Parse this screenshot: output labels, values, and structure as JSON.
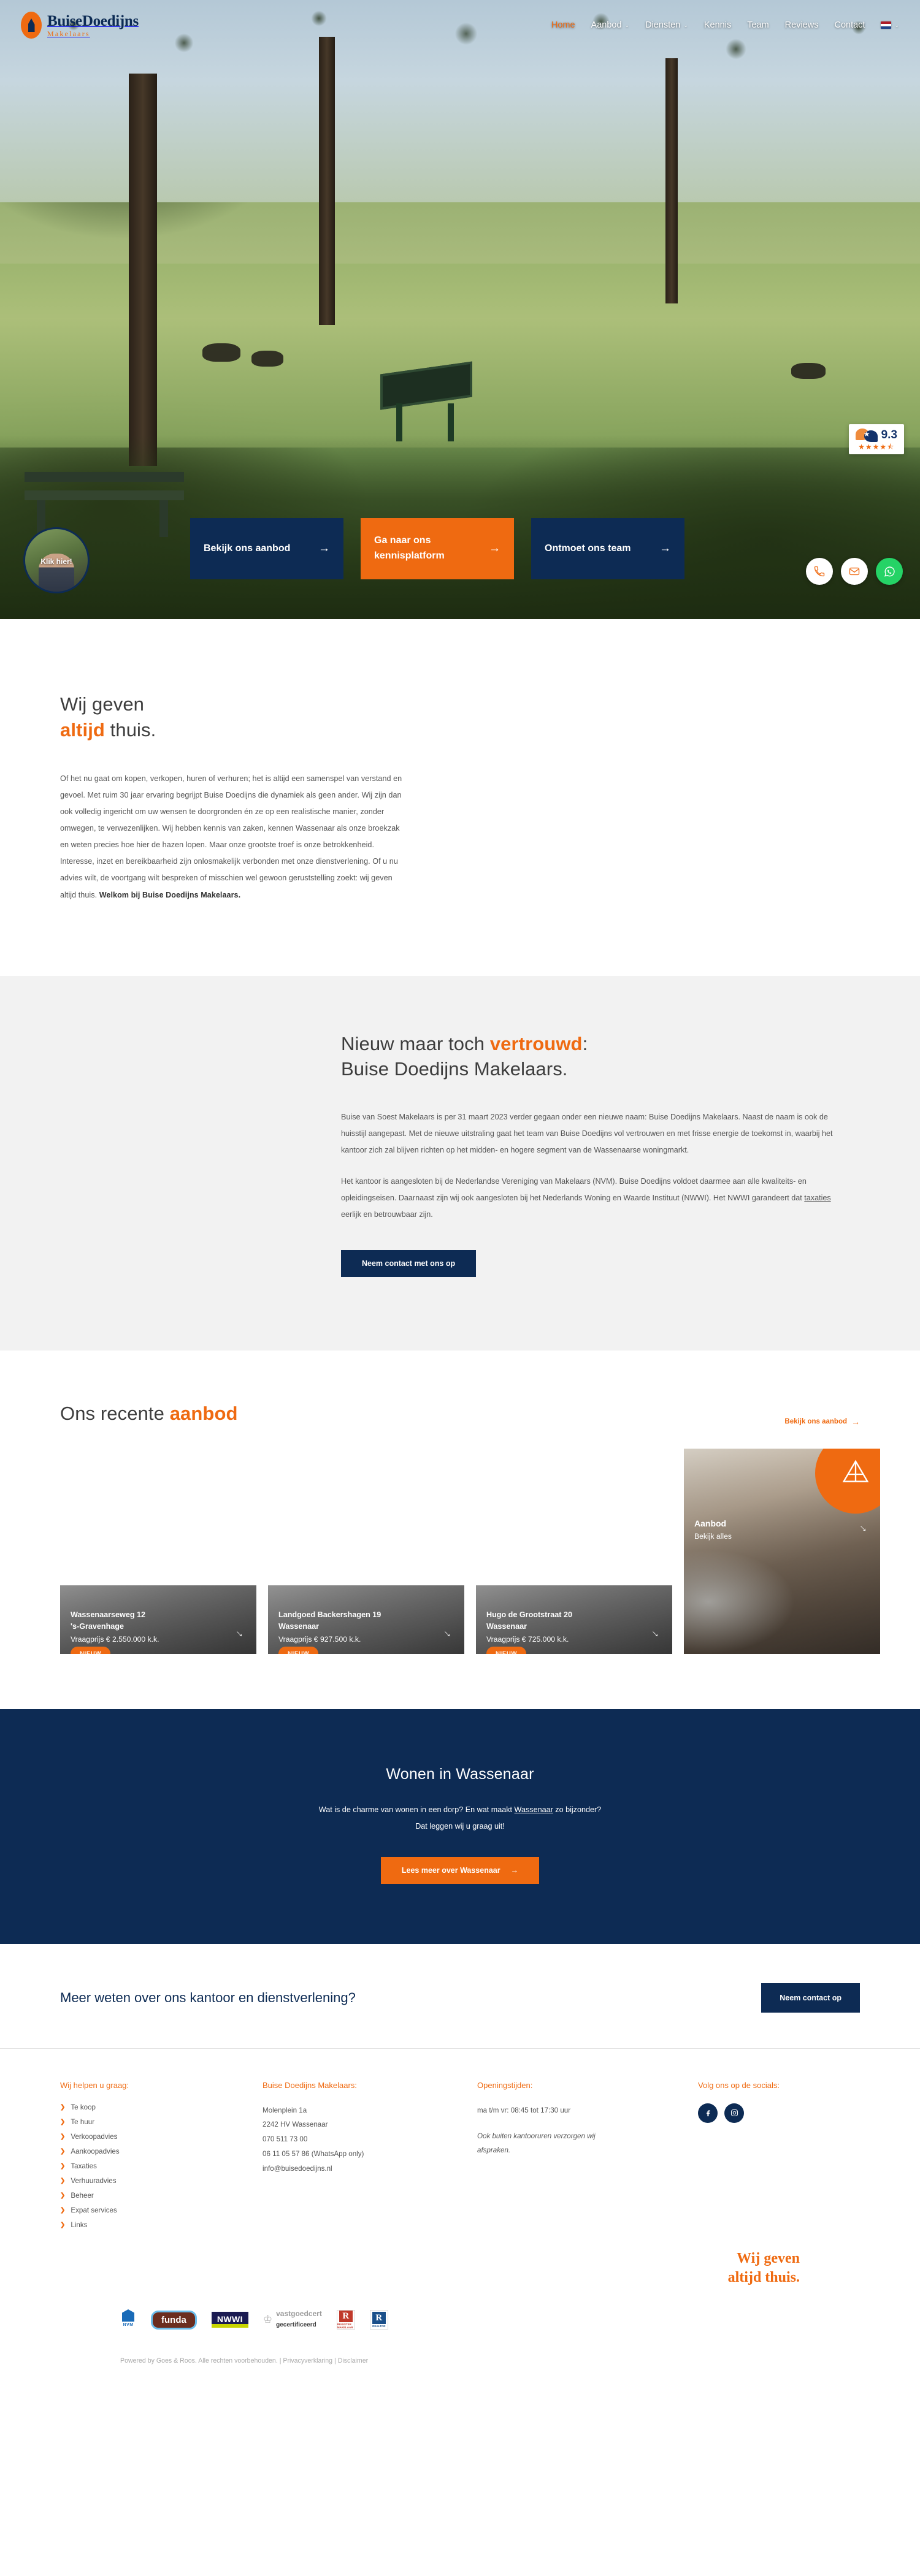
{
  "brand": {
    "name": "BuiseDoedijns",
    "tagline": "Makelaars",
    "accent": "#ef6a11",
    "navy": "#0d2b54"
  },
  "nav": {
    "items": [
      {
        "label": "Home",
        "active": true,
        "caret": ""
      },
      {
        "label": "Aanbod",
        "active": false,
        "caret": "⌄"
      },
      {
        "label": "Diensten",
        "active": false,
        "caret": "⌄"
      },
      {
        "label": "Kennis",
        "active": false,
        "caret": ""
      },
      {
        "label": "Team",
        "active": false,
        "caret": ""
      },
      {
        "label": "Reviews",
        "active": false,
        "caret": ""
      },
      {
        "label": "Contact",
        "active": false,
        "caret": ""
      }
    ],
    "language_caret": "⌄",
    "language_flag": "nl-flag"
  },
  "hero": {
    "rating": {
      "score": "9.3",
      "stars": "★★★★⯪"
    },
    "avatar_label": "Klik hier!",
    "ctas": [
      {
        "label": "Bekijk ons aanbod",
        "style": "navy",
        "arrow": "→"
      },
      {
        "label": "Ga naar ons kennisplatform",
        "style": "orange",
        "arrow": "→"
      },
      {
        "label": "Ontmoet ons team",
        "style": "navy",
        "arrow": "→"
      }
    ],
    "float_actions": [
      {
        "name": "phone-icon",
        "style": "white"
      },
      {
        "name": "mail-icon",
        "style": "white"
      },
      {
        "name": "whatsapp-icon",
        "style": "green"
      }
    ]
  },
  "intro": {
    "title_line1": "Wij geven",
    "title_highlight": "altijd",
    "title_rest": " thuis.",
    "body": "Of het nu gaat om kopen, verkopen, huren of verhuren; het is altijd een samenspel van verstand en gevoel. Met ruim 30 jaar ervaring begrijpt Buise Doedijns die dynamiek als geen ander. Wij zijn dan ook volledig ingericht om uw wensen te doorgronden én ze op een realistische manier, zonder omwegen, te verwezenlijken. Wij hebben kennis van zaken, kennen Wassenaar als onze broekzak en weten precies hoe hier de hazen lopen. Maar onze grootste troef is onze betrokkenheid. Interesse, inzet en bereikbaarheid zijn onlosmakelijk verbonden met onze dienstverlening. Of u nu advies wilt, de voortgang wilt bespreken of misschien wel gewoon geruststelling zoekt: wij geven altijd thuis. ",
    "body_bold": "Welkom bij Buise Doedijns Makelaars."
  },
  "trusted": {
    "title_pre": "Nieuw maar toch ",
    "title_highlight": "vertrouwd",
    "title_suffix": ":",
    "title_line2": "Buise Doedijns Makelaars.",
    "paragraph1": "Buise van Soest Makelaars is per 31 maart 2023 verder gegaan onder een nieuwe naam: Buise Doedijns Makelaars. Naast de naam is ook de huisstijl aangepast. Met de nieuwe uitstraling gaat het team van Buise Doedijns vol vertrouwen en met frisse energie de toekomst in, waarbij het kantoor zich zal blijven richten op het midden- en hogere segment van de Wassenaarse woningmarkt.",
    "paragraph2_pre": "Het kantoor is aangesloten bij de Nederlandse Vereniging van Makelaars (NVM). Buise Doedijns voldoet daarmee aan alle kwaliteits- en opleidingseisen. Daarnaast zijn wij ook aangesloten bij het Nederlands Woning en Waarde Instituut (NWWI). Het NWWI garandeert dat ",
    "paragraph2_link": "taxaties",
    "paragraph2_post": " eerlijk en betrouwbaar zijn.",
    "button": "Neem contact met ons op"
  },
  "offer": {
    "title_pre": "Ons recente ",
    "title_highlight": "aanbod",
    "link": "Bekijk ons aanbod",
    "link_arrow": "→",
    "cards": [
      {
        "address": "Wassenaarseweg 12",
        "city": "'s-Gravenhage",
        "price": "Vraagprijs € 2.550.000 k.k.",
        "badge": "NIEUW",
        "arrow": "→"
      },
      {
        "address": "Landgoed Backershagen 19",
        "city": "Wassenaar",
        "price": "Vraagprijs € 927.500 k.k.",
        "badge": "NIEUW",
        "arrow": "→"
      },
      {
        "address": "Hugo de Grootstraat 20",
        "city": "Wassenaar",
        "price": "Vraagprijs € 725.000 k.k.",
        "badge": "NIEUW",
        "arrow": "→"
      }
    ],
    "feature_card": {
      "title": "Aanbod",
      "subtitle": "Bekijk alles",
      "arrow": "→"
    }
  },
  "wassenaar": {
    "title": "Wonen in Wassenaar",
    "sub_pre": "Wat is de charme van wonen in een dorp? En wat maakt ",
    "sub_link": "Wassenaar",
    "sub_post": " zo bijzonder?",
    "sub_line2": "Dat leggen wij u graag uit!",
    "button": "Lees meer over Wassenaar",
    "button_arrow": "→"
  },
  "more": {
    "title": "Meer weten over ons kantoor en dienstverlening?",
    "button": "Neem contact op"
  },
  "footer": {
    "col_help": {
      "heading": "Wij helpen u graag:",
      "chevron": "❯",
      "items": [
        "Te koop",
        "Te huur",
        "Verkoopadvies",
        "Aankoopadvies",
        "Taxaties",
        "Verhuuradvies",
        "Beheer",
        "Expat services",
        "Links"
      ]
    },
    "col_contact": {
      "heading": "Buise Doedijns Makelaars:",
      "lines": [
        "Molenplein 1a",
        "2242 HV Wassenaar",
        "070 511 73 00",
        "06 11 05 57 86 (WhatsApp only)",
        "info@buisedoedijns.nl"
      ]
    },
    "col_hours": {
      "heading": "Openingstijden:",
      "line": "ma t/m vr: 08:45 tot 17:30 uur",
      "note": "Ook buiten kantooruren verzorgen wij afspraken."
    },
    "col_socials": {
      "heading": "Volg ons op de socials:",
      "items": [
        {
          "name": "facebook-icon"
        },
        {
          "name": "instagram-icon"
        }
      ]
    },
    "tagline_line1": "Wij geven",
    "tagline_line2": "altijd thuis.",
    "partners": [
      {
        "name": "nvm-logo",
        "label": "NVM"
      },
      {
        "name": "funda-logo",
        "label": "funda"
      },
      {
        "name": "nwwi-logo",
        "label": "NWWI"
      },
      {
        "name": "vastgoedcert-logo",
        "label_bold": "vastgoed",
        "label_light": "cert",
        "label_sub": "gecertificeerd"
      },
      {
        "name": "rms-logo",
        "label": "R",
        "label_sub": "REGISTER MAKELAAR"
      },
      {
        "name": "realtor-logo",
        "label": "R",
        "label_sub": "REALTOR"
      }
    ],
    "copyright": "Powered by Goes & Roos. Alle rechten voorbehouden. | ",
    "privacy": "Privacyverklaring",
    "separator": " | ",
    "disclaimer": "Disclaimer"
  }
}
